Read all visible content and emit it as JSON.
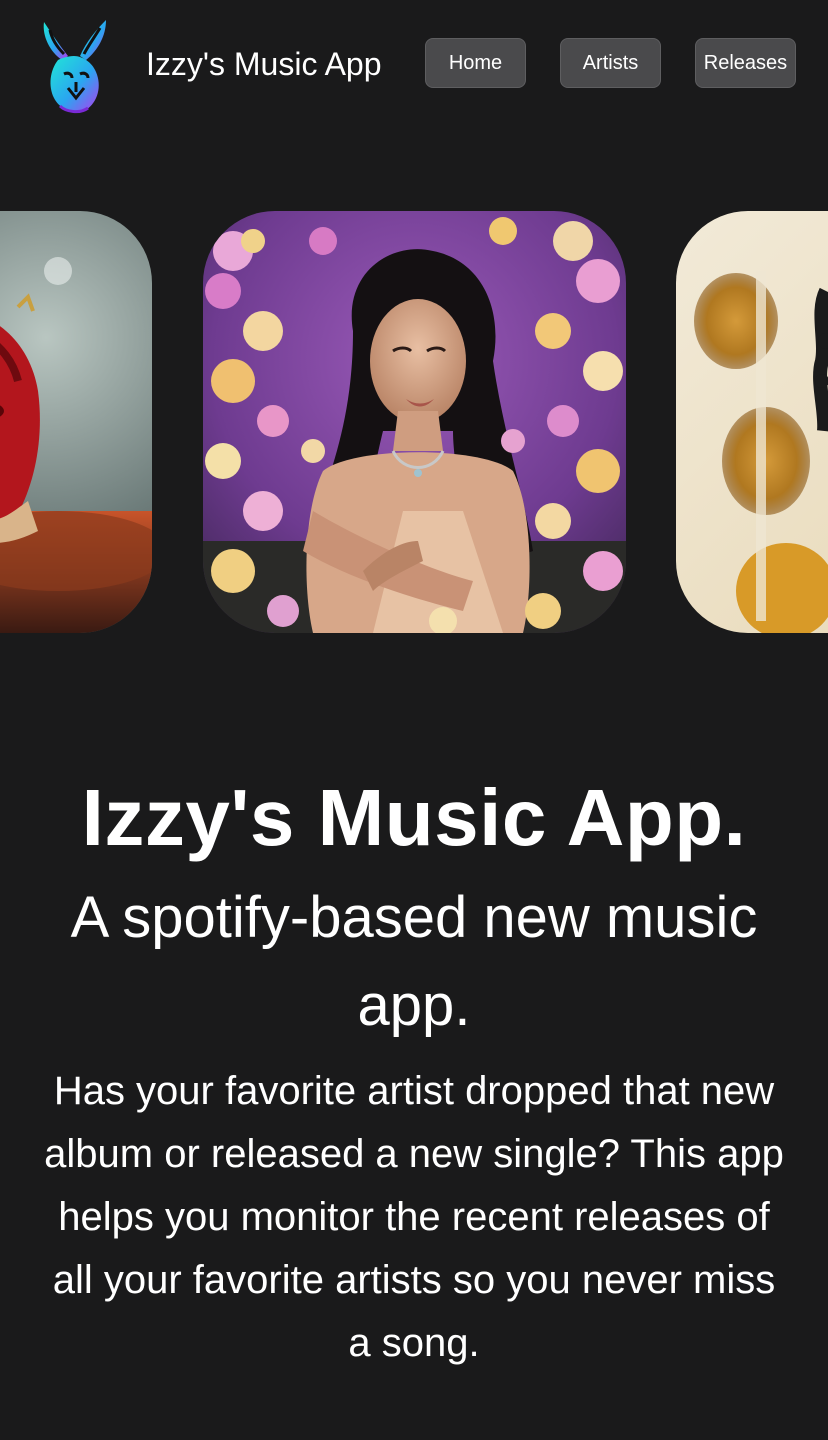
{
  "header": {
    "app_name": "Izzy's Music App",
    "logo_icon": "rabbit-logo-icon",
    "nav": {
      "home_label": "Home",
      "artists_label": "Artists",
      "releases_label": "Releases"
    }
  },
  "carousel": {
    "slides": [
      {
        "icon": "artist-photo-red-mask"
      },
      {
        "icon": "artist-photo-orchids"
      },
      {
        "icon": "artist-photo-amber"
      }
    ]
  },
  "hero": {
    "title": "Izzy's Music App.",
    "subtitle": "A spotify-based new music app.",
    "description": "Has your favorite artist dropped that new album or released a new single? This app helps you monitor the recent releases of all your favorite artists so you never miss a song."
  },
  "colors": {
    "background": "#1a1a1b",
    "nav_button": "#4a4a4c",
    "text": "#ffffff",
    "logo_gradient_start": "#21e6d6",
    "logo_gradient_end": "#b23cf0"
  }
}
